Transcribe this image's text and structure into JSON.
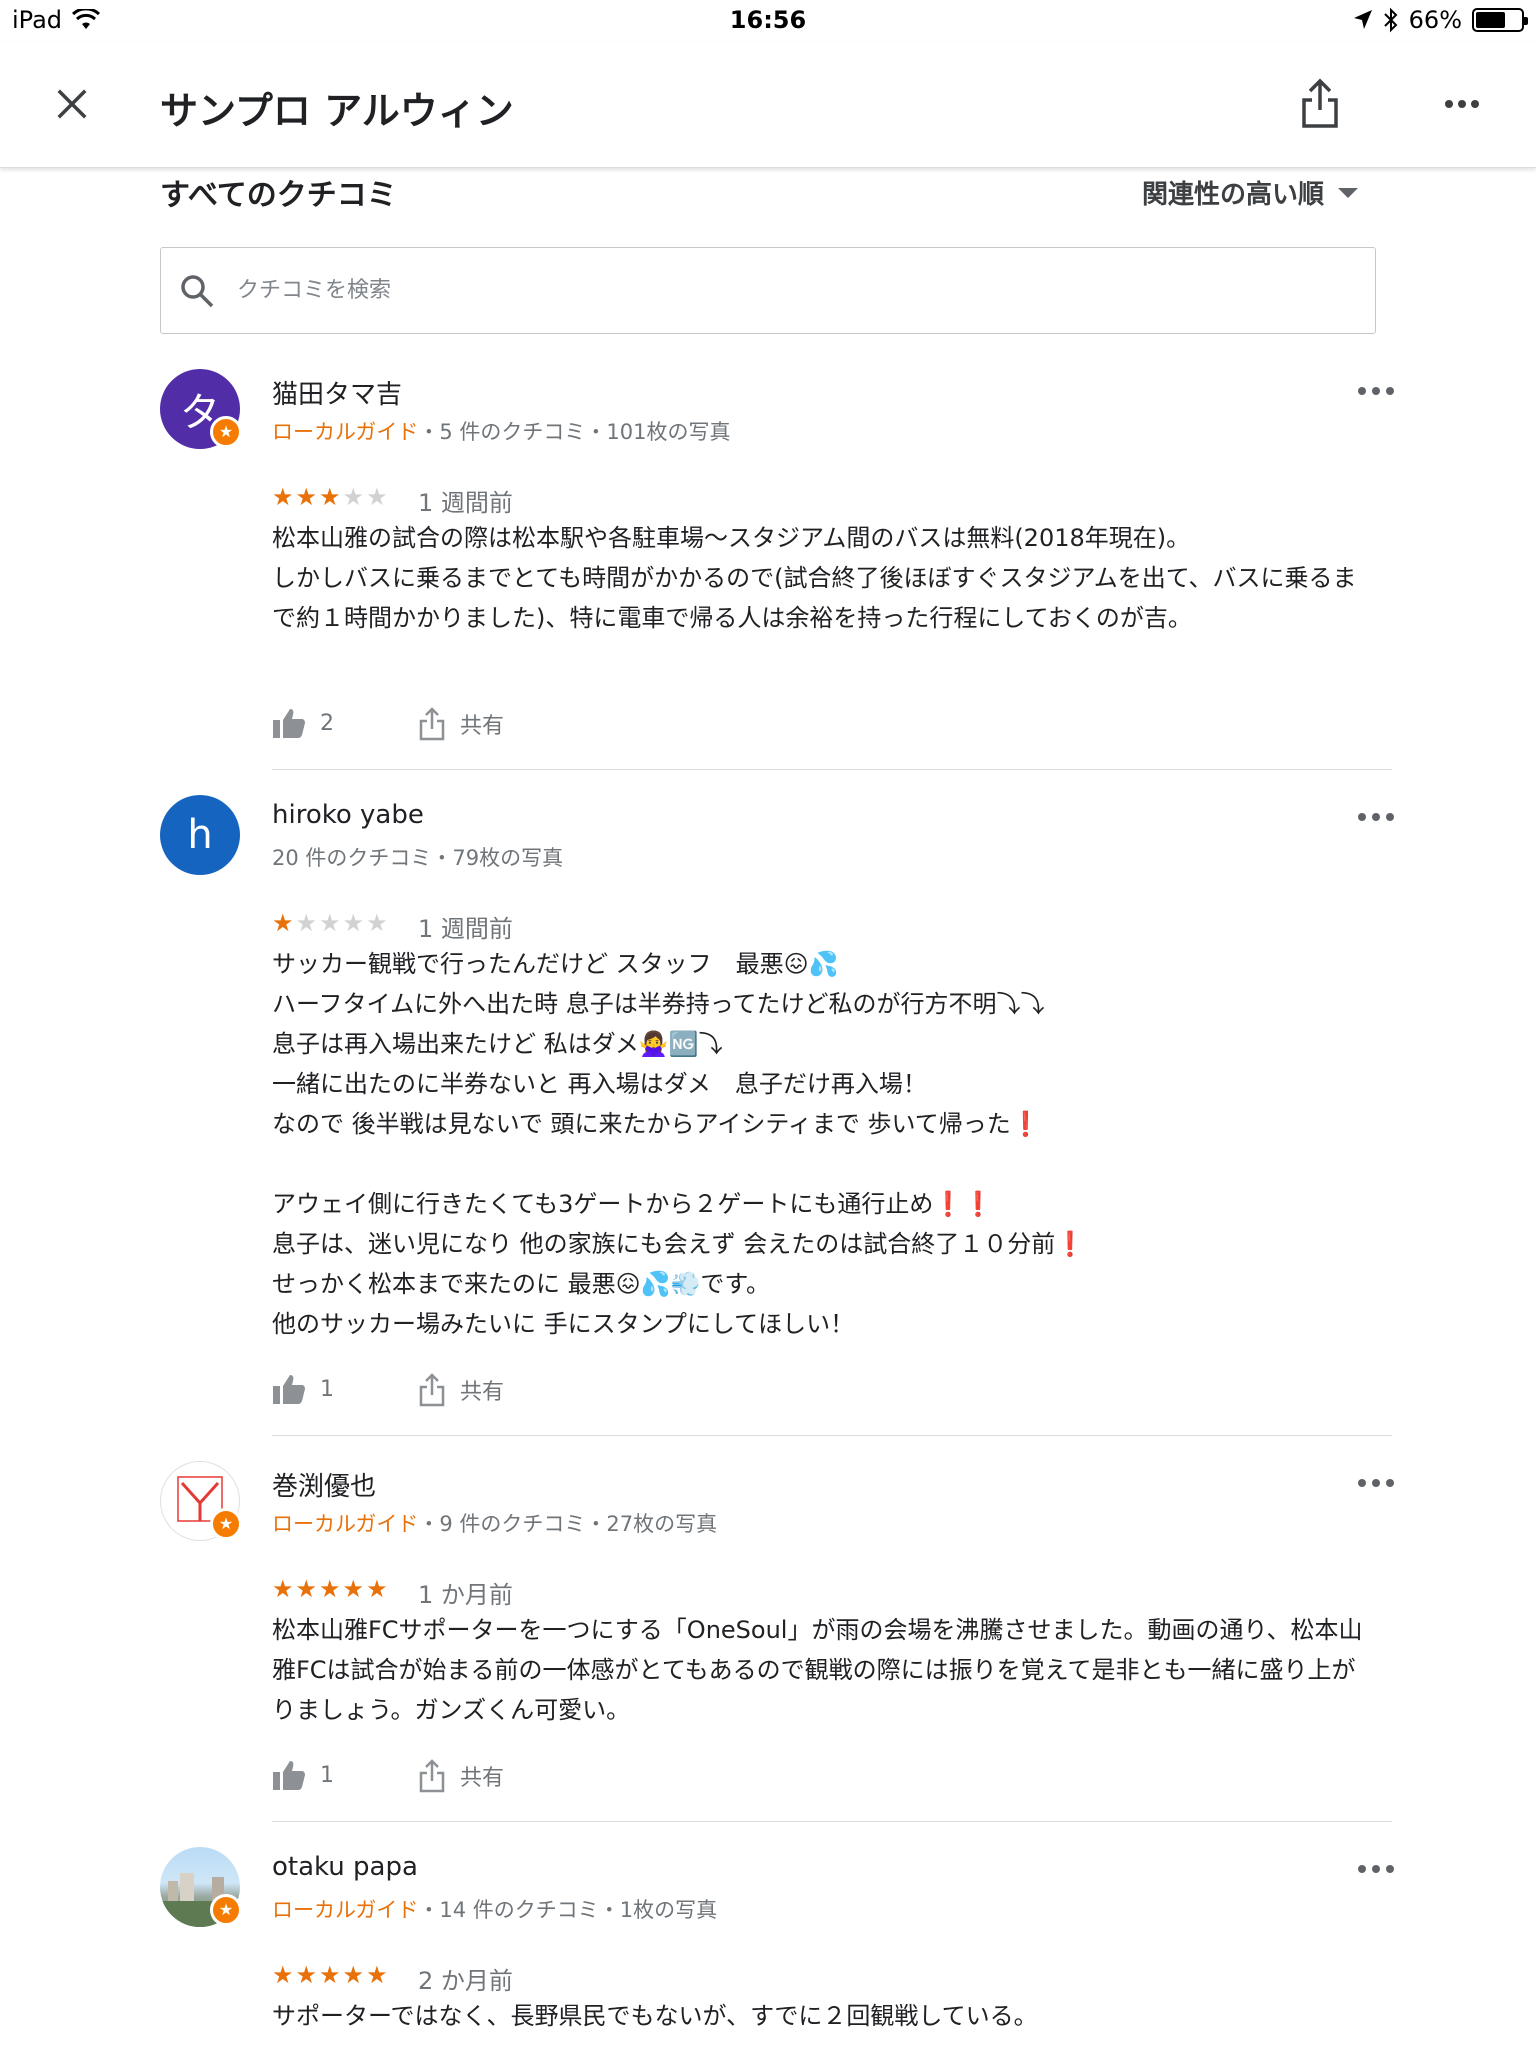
{
  "status_bar": {
    "device": "iPad",
    "time": "16:56",
    "battery": "66%",
    "battery_level": 0.66
  },
  "app_bar": {
    "title": "サンプロ アルウィン",
    "close_icon": "close-icon",
    "share_icon": "share-icon",
    "more_icon": "more-vert-icon"
  },
  "section": {
    "title": "すべてのクチコミ",
    "sort_label": "関連性の高い順"
  },
  "search": {
    "placeholder": "クチコミを検索",
    "value": ""
  },
  "reviews": [
    {
      "avatar_letter": "タ",
      "name": "猫田タマ吉",
      "local_guide": "ローカルガイド",
      "meta": "・5 件のクチコミ・101枚の写真",
      "rating": 3,
      "stars": "★★★★★",
      "date": "1 週間前",
      "text": "松本山雅の試合の際は松本駅や各駐車場〜スタジアム間のバスは無料(2018年現在)。\nしかしバスに乗るまでとても時間がかかるので(試合終了後ほぼすぐスタジアムを出て、バスに乗るまで約１時間かかりました)、特に電車で帰る人は余裕を持った行程にしておくのが吉。",
      "likes": "2",
      "share_label": "共有"
    },
    {
      "avatar_letter": "h",
      "name": "hiroko yabe",
      "local_guide": "",
      "meta": "20 件のクチコミ・79枚の写真",
      "rating": 1,
      "stars": "★★★★★",
      "date": "1 週間前",
      "text": "サッカー観戦で行ったんだけど スタッフ　最悪😖💦\nハーフタイムに外へ出た時 息子は半券持ってたけど私のが行方不明⤵︎⤵︎\n息子は再入場出来たけど 私はダメ🙅‍♀️🆖⤵︎\n一緒に出たのに半券ないと 再入場はダメ　息子だけ再入場！\nなので 後半戦は見ないで 頭に来たからアイシティまで 歩いて帰った❗️\n\nアウェイ側に行きたくても3ゲートから２ゲートにも通行止め❗️❗️\n息子は、迷い児になり 他の家族にも会えず 会えたのは試合終了１０分前❗️\nせっかく松本まで来たのに 最悪😖💦💨です。\n他のサッカー場みたいに 手にスタンプにしてほしい！",
      "likes": "1",
      "share_label": "共有"
    },
    {
      "avatar_letter": "",
      "name": "巻渕優也",
      "local_guide": "ローカルガイド",
      "meta": "・9 件のクチコミ・27枚の写真",
      "rating": 5,
      "stars": "★★★★★",
      "date": "1 か月前",
      "text": "松本山雅FCサポーターを一つにする「OneSoul」が雨の会場を沸騰させました。動画の通り、松本山雅FCは試合が始まる前の一体感がとてもあるので観戦の際には振りを覚えて是非とも一緒に盛り上がりましょう。ガンズくん可愛い。",
      "likes": "1",
      "share_label": "共有"
    },
    {
      "avatar_letter": "",
      "name": "otaku papa",
      "local_guide": "ローカルガイド",
      "meta": "・14 件のクチコミ・1枚の写真",
      "rating": 5,
      "stars": "★★★★★",
      "date": "2 か月前",
      "text": "サポーターではなく、長野県民でもないが、すでに２回観戦している。",
      "likes": "",
      "share_label": ""
    }
  ],
  "colors": {
    "accent_orange": "#e8710a",
    "avatar_purple": "#512da8",
    "avatar_blue": "#1565c0",
    "text_secondary": "#70757a"
  }
}
